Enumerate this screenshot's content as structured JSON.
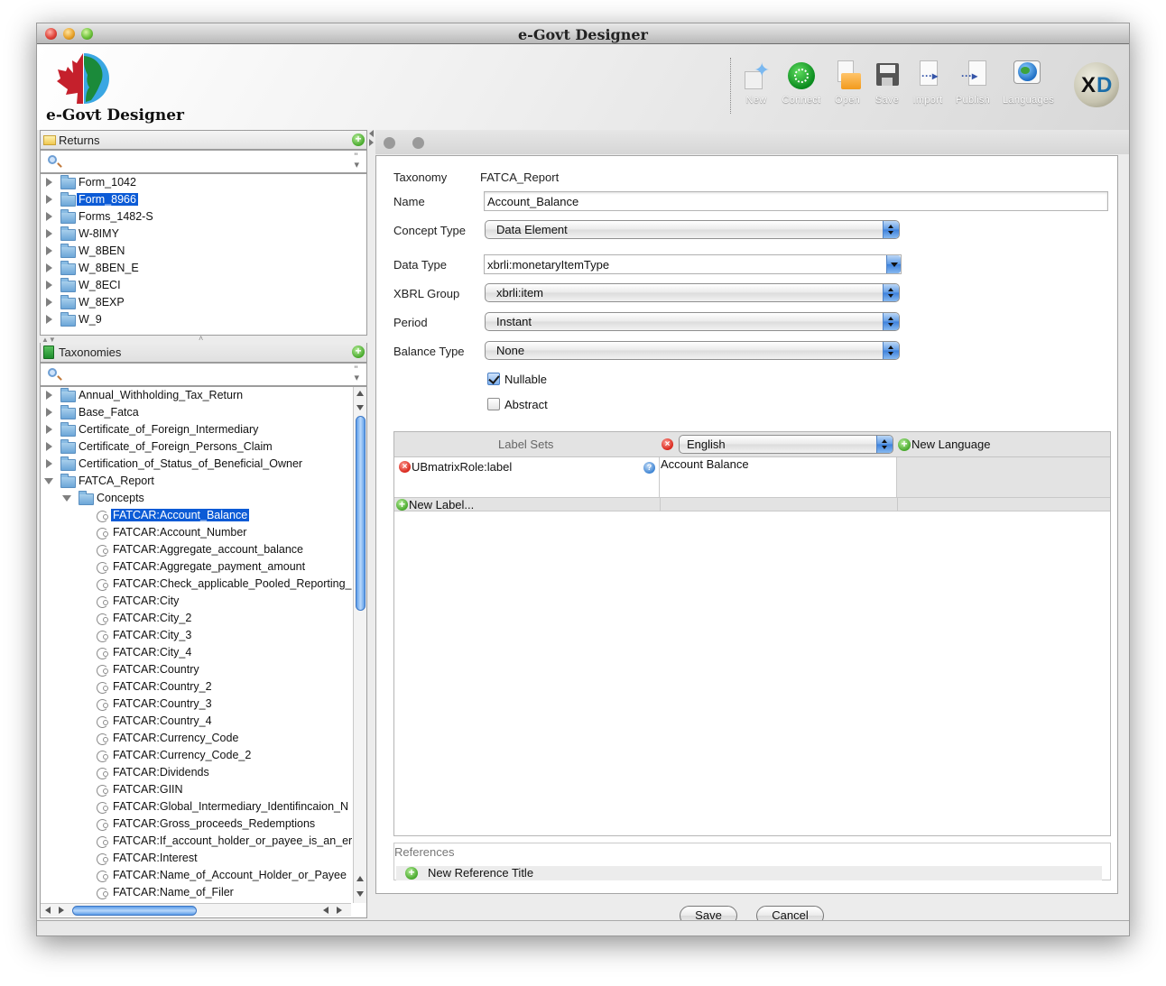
{
  "window": {
    "title": "e-Govt Designer"
  },
  "header": {
    "brand": "e-Govt Designer",
    "toolbar": [
      {
        "id": "new",
        "label": "New",
        "icon": "new-document-sparkle-icon"
      },
      {
        "id": "connect",
        "label": "Connect",
        "icon": "connect-icon"
      },
      {
        "id": "open",
        "label": "Open",
        "icon": "open-folder-icon"
      },
      {
        "id": "save",
        "label": "Save",
        "icon": "floppy-disk-icon"
      },
      {
        "id": "import",
        "label": "Import",
        "icon": "import-icon"
      },
      {
        "id": "publish",
        "label": "Publish",
        "icon": "publish-icon"
      },
      {
        "id": "languages",
        "label": "Languages",
        "icon": "globe-speech-icon"
      }
    ],
    "xd_logo": {
      "x": "X",
      "d": "D"
    }
  },
  "returns": {
    "title": "Returns",
    "search_placeholder": "",
    "items": [
      {
        "label": "Form_1042",
        "selected": false
      },
      {
        "label": "Form_8966",
        "selected": true
      },
      {
        "label": "Forms_1482-S",
        "selected": false
      },
      {
        "label": "W-8IMY",
        "selected": false
      },
      {
        "label": "W_8BEN",
        "selected": false
      },
      {
        "label": "W_8BEN_E",
        "selected": false
      },
      {
        "label": "W_8ECI",
        "selected": false
      },
      {
        "label": "W_8EXP",
        "selected": false
      },
      {
        "label": "W_9",
        "selected": false
      }
    ]
  },
  "taxonomies": {
    "title": "Taxonomies",
    "search_placeholder": "",
    "folders": [
      {
        "label": "Annual_Withholding_Tax_Return",
        "expanded": false
      },
      {
        "label": "Base_Fatca",
        "expanded": false
      },
      {
        "label": "Certificate_of_Foreign_Intermediary",
        "expanded": false
      },
      {
        "label": "Certificate_of_Foreign_Persons_Claim",
        "expanded": false
      },
      {
        "label": "Certification_of_Status_of_Beneficial_Owner",
        "expanded": false
      },
      {
        "label": "FATCA_Report",
        "expanded": true
      }
    ],
    "subfolder": {
      "label": "Concepts",
      "expanded": true
    },
    "concepts": [
      {
        "label": "FATCAR:Account_Balance",
        "selected": true
      },
      {
        "label": "FATCAR:Account_Number",
        "selected": false
      },
      {
        "label": "FATCAR:Aggregate_account_balance",
        "selected": false
      },
      {
        "label": "FATCAR:Aggregate_payment_amount",
        "selected": false
      },
      {
        "label": "FATCAR:Check_applicable_Pooled_Reporting_",
        "selected": false
      },
      {
        "label": "FATCAR:City",
        "selected": false
      },
      {
        "label": "FATCAR:City_2",
        "selected": false
      },
      {
        "label": "FATCAR:City_3",
        "selected": false
      },
      {
        "label": "FATCAR:City_4",
        "selected": false
      },
      {
        "label": "FATCAR:Country",
        "selected": false
      },
      {
        "label": "FATCAR:Country_2",
        "selected": false
      },
      {
        "label": "FATCAR:Country_3",
        "selected": false
      },
      {
        "label": "FATCAR:Country_4",
        "selected": false
      },
      {
        "label": "FATCAR:Currency_Code",
        "selected": false
      },
      {
        "label": "FATCAR:Currency_Code_2",
        "selected": false
      },
      {
        "label": "FATCAR:Dividends",
        "selected": false
      },
      {
        "label": "FATCAR:GIIN",
        "selected": false
      },
      {
        "label": "FATCAR:Global_Intermediary_Identifincaion_N",
        "selected": false
      },
      {
        "label": "FATCAR:Gross_proceeds_Redemptions",
        "selected": false
      },
      {
        "label": "FATCAR:If_account_holder_or_payee_is_an_er",
        "selected": false
      },
      {
        "label": "FATCAR:Interest",
        "selected": false
      },
      {
        "label": "FATCAR:Name_of_Account_Holder_or_Payee",
        "selected": false
      },
      {
        "label": "FATCAR:Name_of_Filer",
        "selected": false
      }
    ]
  },
  "form": {
    "taxonomy_label": "Taxonomy",
    "taxonomy_value": "FATCA_Report",
    "name_label": "Name",
    "name_value": "Account_Balance",
    "concept_type_label": "Concept Type",
    "concept_type_value": "Data Element",
    "data_type_label": "Data Type",
    "data_type_value": "xbrli:monetaryItemType",
    "xbrl_group_label": "XBRL Group",
    "xbrl_group_value": "xbrli:item",
    "period_label": "Period",
    "period_value": "Instant",
    "balance_type_label": "Balance Type",
    "balance_type_value": "None",
    "nullable_label": "Nullable",
    "nullable_checked": true,
    "abstract_label": "Abstract",
    "abstract_checked": false
  },
  "label_sets": {
    "header": "Label Sets",
    "language_value": "English",
    "new_language": "New Language",
    "rows": [
      {
        "role": "UBmatrixRole:label",
        "value": "Account Balance"
      }
    ],
    "new_label": "New Label..."
  },
  "references": {
    "title": "References",
    "new_reference": "New Reference Title"
  },
  "buttons": {
    "save": "Save",
    "cancel": "Cancel"
  }
}
